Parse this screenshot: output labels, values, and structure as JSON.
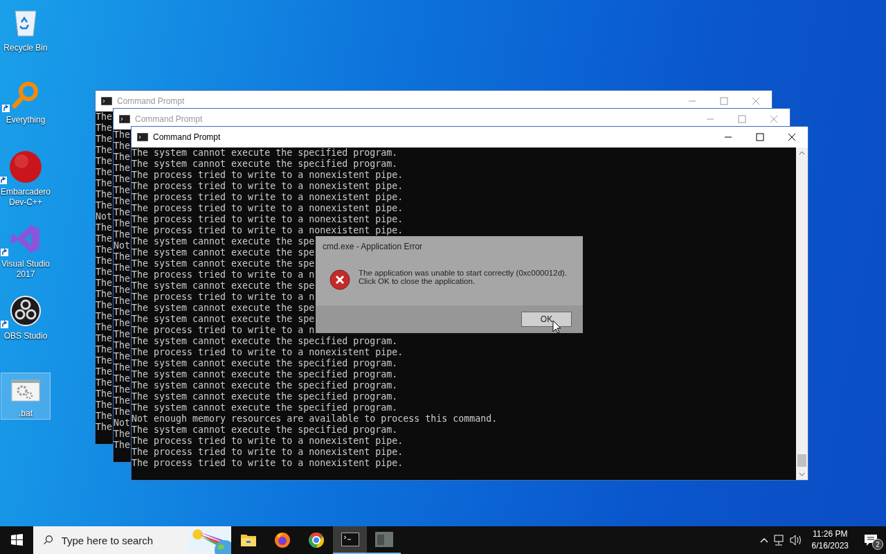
{
  "desktop_icons": [
    {
      "label": "Recycle Bin",
      "kind": "recycle",
      "shortcut": false,
      "selected": false
    },
    {
      "label": "Everything",
      "kind": "magnifier",
      "shortcut": true,
      "selected": false
    },
    {
      "label": "Embarcadero Dev-C++",
      "kind": "devcpp",
      "shortcut": true,
      "selected": false
    },
    {
      "label": "Visual Studio 2017",
      "kind": "vs",
      "shortcut": true,
      "selected": false
    },
    {
      "label": "OBS Studio",
      "kind": "obs",
      "shortcut": true,
      "selected": false
    },
    {
      "label": ".bat",
      "kind": "batch",
      "shortcut": false,
      "selected": true
    }
  ],
  "windows": [
    {
      "title": "Command Prompt",
      "active": false,
      "lines": [
        "The",
        "The",
        "The",
        "The",
        "The",
        "The",
        "The",
        "The",
        "The",
        "Not",
        "The",
        "The",
        "The",
        "The",
        "The",
        "The",
        "The",
        "The",
        "The",
        "The",
        "The",
        "The",
        "The",
        "The",
        "The",
        "The",
        "The",
        "The",
        "The"
      ]
    },
    {
      "title": "Command Prompt",
      "active": false,
      "lines": [
        "The",
        "The",
        "The",
        "The",
        "The",
        "The",
        "The",
        "The",
        "The",
        "The",
        "Not",
        "The",
        "The",
        "The",
        "The",
        "The",
        "The",
        "The",
        "The",
        "The",
        "The",
        "The",
        "The",
        "The",
        "The",
        "The",
        "Not",
        "The",
        "The"
      ]
    },
    {
      "title": "Command Prompt",
      "active": true,
      "lines": [
        "The system cannot execute the specified program.",
        "The system cannot execute the specified program.",
        "The process tried to write to a nonexistent pipe.",
        "The process tried to write to a nonexistent pipe.",
        "The process tried to write to a nonexistent pipe.",
        "The process tried to write to a nonexistent pipe.",
        "The process tried to write to a nonexistent pipe.",
        "The process tried to write to a nonexistent pipe.",
        "The system cannot execute the spe",
        "The system cannot execute the spe",
        "The system cannot execute the spe",
        "The process tried to write to a n",
        "The system cannot execute the spe",
        "The process tried to write to a n",
        "The system cannot execute the spe",
        "The system cannot execute the spe",
        "The process tried to write to a n",
        "The system cannot execute the specified program.",
        "The process tried to write to a nonexistent pipe.",
        "The system cannot execute the specified program.",
        "The system cannot execute the specified program.",
        "The system cannot execute the specified program.",
        "The system cannot execute the specified program.",
        "The system cannot execute the specified program.",
        "Not enough memory resources are available to process this command.",
        "The system cannot execute the specified program.",
        "The process tried to write to a nonexistent pipe.",
        "The process tried to write to a nonexistent pipe.",
        "The process tried to write to a nonexistent pipe."
      ]
    }
  ],
  "dialog": {
    "title": "cmd.exe - Application Error",
    "message": [
      "The application was unable to start correctly (0xc000012d).",
      "Click OK to close the application."
    ],
    "button": "OK"
  },
  "taskbar": {
    "search": {
      "placeholder": "Type here to search"
    },
    "apps": [
      {
        "kind": "explorer",
        "running": false,
        "active": false
      },
      {
        "kind": "firefox",
        "running": false,
        "active": false
      },
      {
        "kind": "chrome",
        "running": false,
        "active": false
      },
      {
        "kind": "terminal",
        "running": true,
        "active": true
      },
      {
        "kind": "window",
        "running": true,
        "active": false
      }
    ],
    "time": "11:26 PM",
    "date": "6/16/2023",
    "notifications": "2"
  }
}
